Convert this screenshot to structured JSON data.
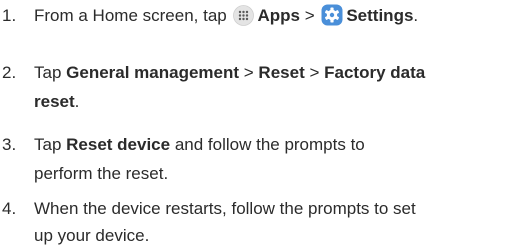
{
  "steps": [
    {
      "number": "1.",
      "text_a": "From a Home screen, tap ",
      "apps_icon": "apps-grid-icon",
      "apps_label": "Apps",
      "sep": " > ",
      "settings_icon": "settings-gear-icon",
      "settings_label": "Settings",
      "end": "."
    },
    {
      "number": "2.",
      "text_a": "Tap ",
      "b1": "General management",
      "sep1": " > ",
      "b2": "Reset",
      "sep2": " > ",
      "b3": "Factory data",
      "b3_cont": "reset",
      "end": "."
    },
    {
      "number": "3.",
      "text_a": "Tap ",
      "b1": "Reset device",
      "line1_rest": " and follow the prompts to",
      "line2": "perform the reset."
    },
    {
      "number": "4.",
      "line1": "When the device restarts, follow the prompts to set",
      "line2": "up your device."
    }
  ],
  "colors": {
    "text": "#2b2b2b",
    "apps_icon_bg": "#e4e4e4",
    "settings_icon_bg": "#4a8fd9"
  }
}
